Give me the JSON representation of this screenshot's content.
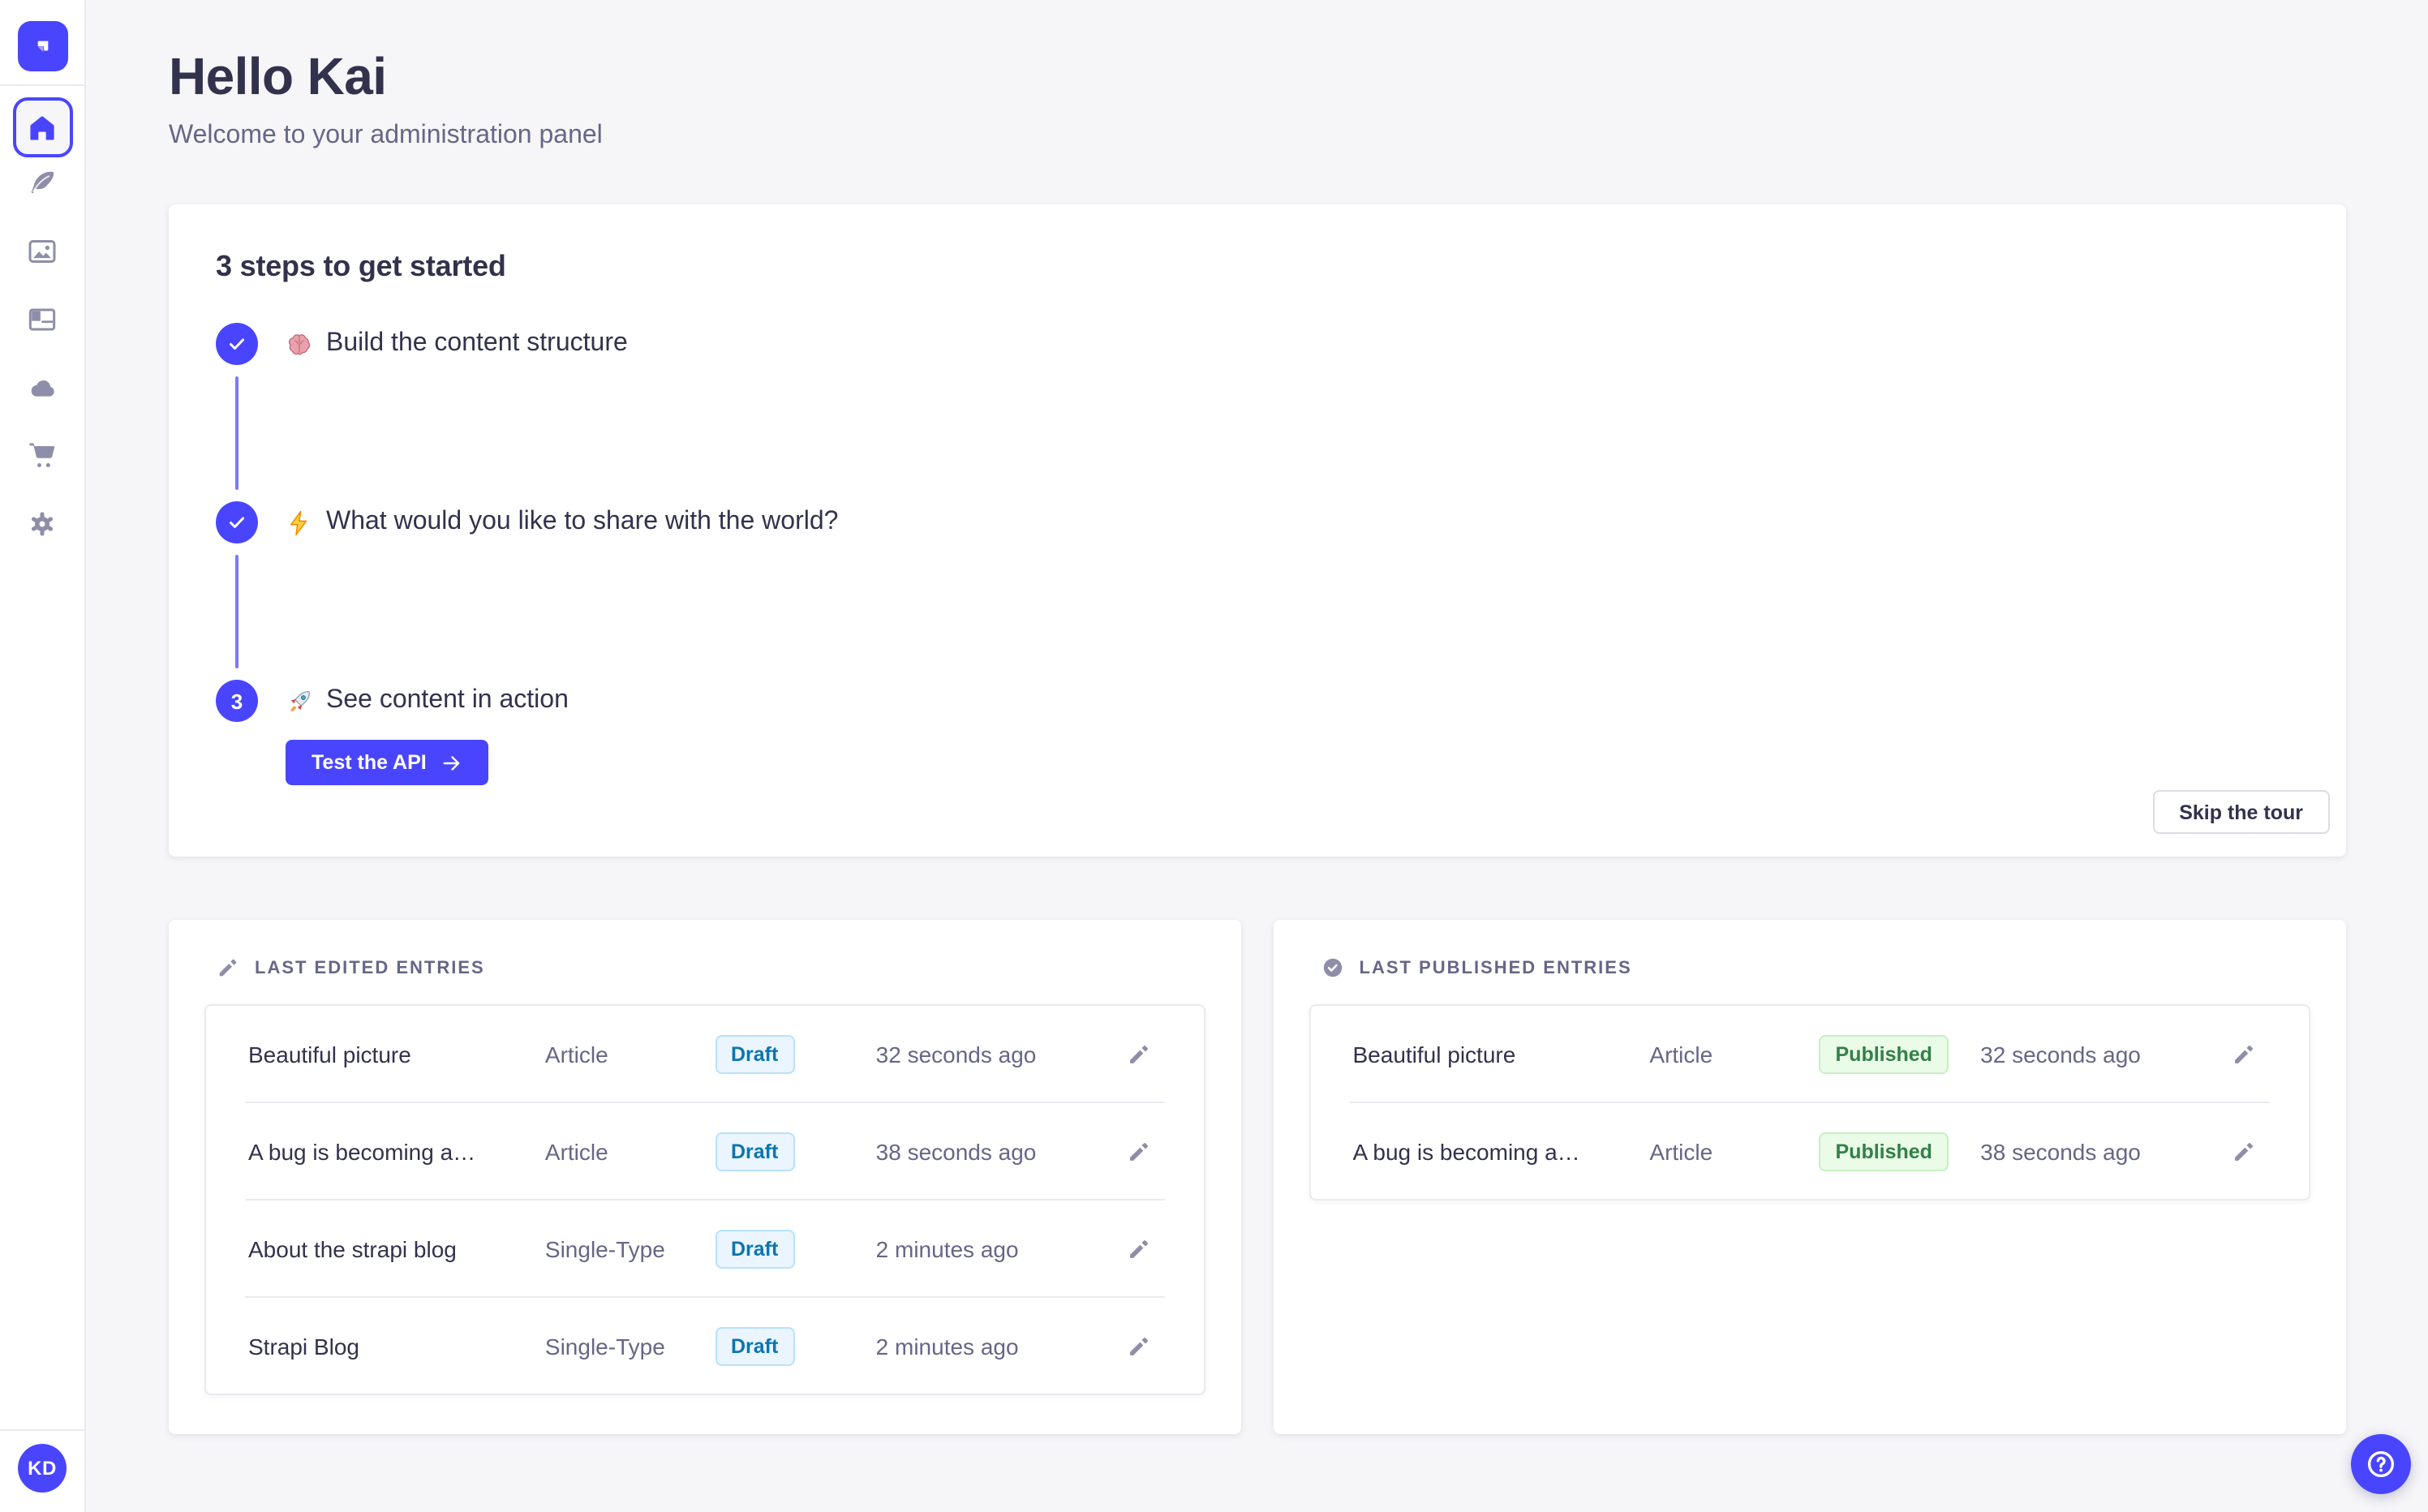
{
  "colors": {
    "accent": "#4945ff",
    "connector": "#7b79ff",
    "page_bg": "#f6f6f9",
    "card_bg": "#ffffff",
    "text_primary": "#32324d",
    "text_secondary": "#666687",
    "icon_gray": "#8e8ea9",
    "border": "#eaeaef",
    "draft": {
      "bg": "#eaf5ff",
      "border": "#b8e1ff",
      "text": "#0c75af"
    },
    "published": {
      "bg": "#eafbe7",
      "border": "#c6f0c2",
      "text": "#328048"
    }
  },
  "sidebar": {
    "logo_icon": "strapi-logo-icon",
    "nav_icons": [
      "home-icon",
      "feather-icon",
      "picture-icon",
      "layout-icon",
      "cloud-icon",
      "cart-icon",
      "gear-icon"
    ],
    "active_item": "home",
    "avatar_initials": "KD"
  },
  "header": {
    "title": "Hello Kai",
    "subtitle": "Welcome to your administration panel"
  },
  "onboarding": {
    "title": "3 steps to get started",
    "steps": [
      {
        "icon": "brain-icon",
        "label": "Build the content structure",
        "state": "done"
      },
      {
        "icon": "zap-icon",
        "label": "What would you like to share with the world?",
        "state": "done"
      },
      {
        "icon": "rocket-icon",
        "label": "See content in action",
        "state": "current",
        "number": "3"
      }
    ],
    "cta_label": "Test the API",
    "skip_label": "Skip the tour"
  },
  "panels": [
    {
      "title": "LAST EDITED ENTRIES",
      "icon": "pencil-icon",
      "status_variant": "draft",
      "rows": [
        {
          "title": "Beautiful picture",
          "type": "Article",
          "status": "Draft",
          "time": "32 seconds ago"
        },
        {
          "title": "A bug is becoming a…",
          "type": "Article",
          "status": "Draft",
          "time": "38 seconds ago"
        },
        {
          "title": "About the strapi blog",
          "type": "Single-Type",
          "status": "Draft",
          "time": "2 minutes ago"
        },
        {
          "title": "Strapi Blog",
          "type": "Single-Type",
          "status": "Draft",
          "time": "2 minutes ago"
        }
      ]
    },
    {
      "title": "LAST PUBLISHED ENTRIES",
      "icon": "check-circle-icon",
      "status_variant": "published",
      "rows": [
        {
          "title": "Beautiful picture",
          "type": "Article",
          "status": "Published",
          "time": "32 seconds ago"
        },
        {
          "title": "A bug is becoming a…",
          "type": "Article",
          "status": "Published",
          "time": "38 seconds ago"
        }
      ]
    }
  ],
  "help": {
    "icon": "question-circle-icon"
  }
}
